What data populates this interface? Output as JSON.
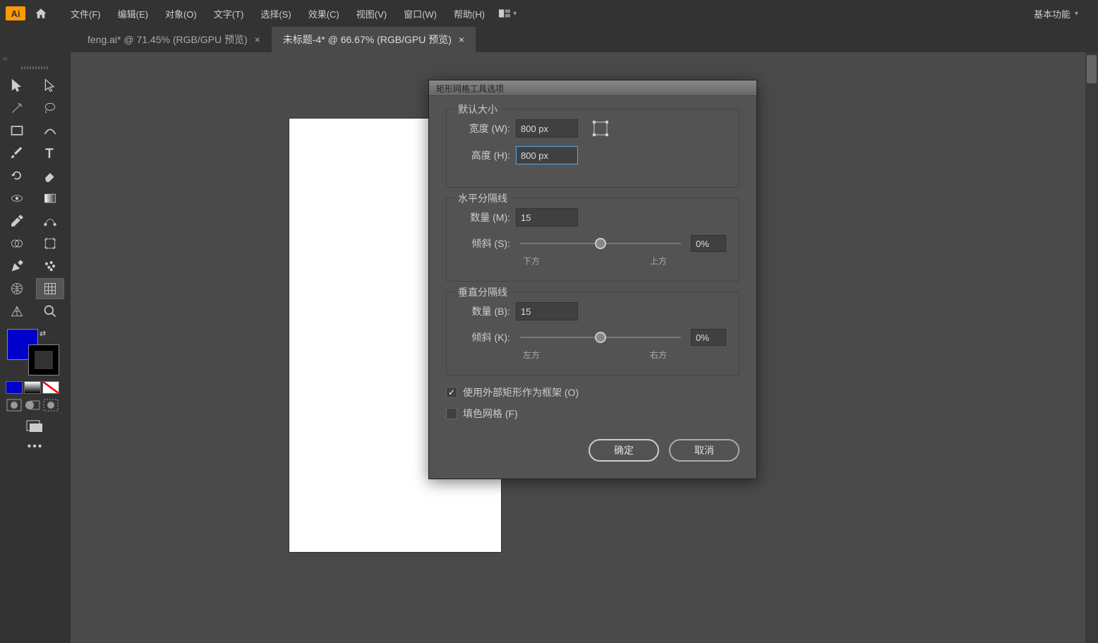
{
  "app": {
    "logo": "Ai"
  },
  "menu": {
    "items": [
      "文件(F)",
      "编辑(E)",
      "对象(O)",
      "文字(T)",
      "选择(S)",
      "效果(C)",
      "视图(V)",
      "窗口(W)",
      "帮助(H)"
    ]
  },
  "workspace": {
    "label": "基本功能"
  },
  "tabs": [
    {
      "label": "feng.ai* @ 71.45% (RGB/GPU 预览)",
      "active": false
    },
    {
      "label": "未标题-4* @ 66.67% (RGB/GPU 预览)",
      "active": true
    }
  ],
  "dialog": {
    "title": "矩形网格工具选项",
    "default_size": {
      "title": "默认大小",
      "width_label": "宽度 (W):",
      "width_value": "800 px",
      "height_label": "高度 (H):",
      "height_value": "800 px"
    },
    "horizontal": {
      "title": "水平分隔线",
      "count_label": "数量 (M):",
      "count_value": "15",
      "skew_label": "倾斜 (S):",
      "skew_pct": "0%",
      "low_label": "下方",
      "high_label": "上方"
    },
    "vertical": {
      "title": "垂直分隔线",
      "count_label": "数量 (B):",
      "count_value": "15",
      "skew_label": "倾斜 (K):",
      "skew_pct": "0%",
      "low_label": "左方",
      "high_label": "右方"
    },
    "frame_checkbox": "使用外部矩形作为框架 (O)",
    "fill_checkbox": "填色网格 (F)",
    "ok": "确定",
    "cancel": "取消"
  }
}
